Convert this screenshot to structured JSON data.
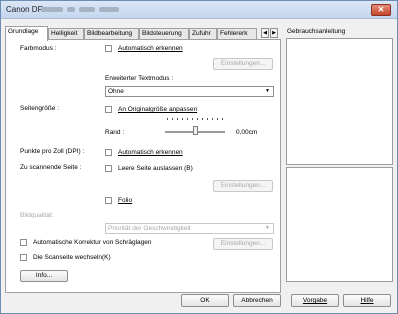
{
  "window": {
    "title_prefix": "Canon DR-",
    "close_glyph": "✕"
  },
  "tabs": [
    {
      "label": "Grundlage"
    },
    {
      "label": "Helligkeit"
    },
    {
      "label": "Bildbearbeitung"
    },
    {
      "label": "Bildsteuerung"
    },
    {
      "label": "Zufuhr"
    },
    {
      "label": "Fehlererk"
    }
  ],
  "tab_scroll": {
    "left": "◀",
    "right": "▶"
  },
  "help": {
    "label": "Gebrauchsanleitung"
  },
  "basic": {
    "farbmodus_label": "Farbmodus :",
    "auto_detect_label": "Automatisch erkennen",
    "settings_btn_1": "Einstellungen...",
    "extended_text_label": "Erweiterter Textmodus :",
    "extended_text_value": "Ohne",
    "page_size_label": "Seitengröße :",
    "fit_original_label": "An Originalgröße anpassen",
    "margin_label": "Rand :",
    "margin_value": "0,00cm",
    "dpi_label": "Punkte pro Zoll (DPI) :",
    "dpi_auto_label": "Automatisch erkennen",
    "page_to_scan_label": "Zu scannende Seite :",
    "skip_blank_label": "Leere Seite auslassen (B)",
    "settings_btn_2": "Einstellungen...",
    "folio_label": "Folio",
    "quality_label": "Bildqualität:",
    "quality_value": "Priorität der Geschwindigkeit",
    "deskew_label": "Automatische Korrektur von Schräglagen",
    "settings_btn_3": "Einstellungen...",
    "swap_sides_label": "Die Scanseite wechseln(K)",
    "info_btn": "Info..."
  },
  "footer": {
    "ok": "OK",
    "cancel": "Abbrechen",
    "defaults": "Vorgabe",
    "help": "Hilfe"
  },
  "state": {
    "farbmodus_auto": false,
    "fit_original": false,
    "dpi_auto": false,
    "skip_blank": false,
    "folio": false,
    "deskew": false,
    "swap_sides": false,
    "margin_slider_position": 0.5
  },
  "icons": {
    "close": "close-icon",
    "dropdown": "chevron-down-icon",
    "scroll_left": "chevron-left-icon",
    "scroll_right": "chevron-right-icon"
  },
  "colors": {
    "title_gradient_top": "#dbe7f6",
    "close_red": "#c5452c",
    "disabled_text": "#a8a8a8"
  }
}
